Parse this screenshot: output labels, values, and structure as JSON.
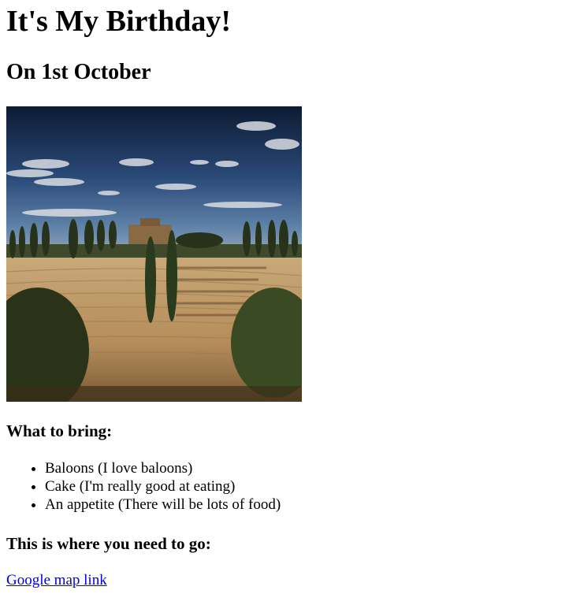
{
  "page": {
    "title": "It's My Birthday!",
    "date": "On 1st October",
    "image": {
      "description_icon": "landscape-photo"
    },
    "bring": {
      "heading": "What to bring:",
      "items": [
        {
          "label": "Baloons (I love baloons)"
        },
        {
          "label": "Cake (I'm really good at eating)"
        },
        {
          "label": "An appetite (There will be lots of food)"
        }
      ]
    },
    "directions": {
      "heading": "This is where you need to go:",
      "link_label": "Google map link"
    }
  },
  "colors": {
    "link": "#0000ee",
    "text": "#000000",
    "background": "#ffffff"
  }
}
